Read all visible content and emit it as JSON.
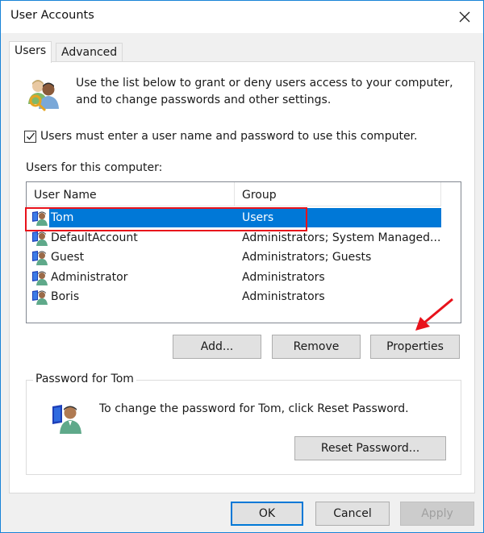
{
  "window": {
    "title": "User Accounts",
    "close_icon": "close-icon"
  },
  "tabs": [
    {
      "label": "Users",
      "active": true
    },
    {
      "label": "Advanced",
      "active": false
    }
  ],
  "users_tab": {
    "intro_icon": "users-key-icon",
    "intro_text_line1": "Use the list below to grant or deny users access to your computer,",
    "intro_text_line2": "and to change passwords and other settings.",
    "require_login_checkbox": {
      "label": "Users must enter a user name and password to use this computer.",
      "checked": true
    },
    "users_list_label": "Users for this computer:",
    "list": {
      "columns": [
        "User Name",
        "Group"
      ],
      "rows": [
        {
          "name": "Tom",
          "group": "Users",
          "selected": true,
          "icon": "user-computer-icon"
        },
        {
          "name": "DefaultAccount",
          "group": "Administrators; System Managed...",
          "selected": false,
          "icon": "user-computer-icon"
        },
        {
          "name": "Guest",
          "group": "Administrators; Guests",
          "selected": false,
          "icon": "user-computer-icon"
        },
        {
          "name": "Administrator",
          "group": "Administrators",
          "selected": false,
          "icon": "user-computer-icon"
        },
        {
          "name": "Boris",
          "group": "Administrators",
          "selected": false,
          "icon": "user-computer-icon"
        }
      ]
    },
    "buttons": {
      "add": "Add...",
      "remove": "Remove",
      "properties": "Properties"
    },
    "password_group": {
      "legend": "Password for Tom",
      "icon": "user-computer-icon",
      "text": "To change the password for Tom, click Reset Password.",
      "reset_button": "Reset Password..."
    }
  },
  "footer": {
    "ok": "OK",
    "cancel": "Cancel",
    "apply": "Apply",
    "apply_enabled": false
  },
  "annotations": {
    "highlight_color": "#e8121b",
    "arrow_color": "#e8121b"
  },
  "colors": {
    "selection": "#0078d7",
    "window_border": "#1883d7"
  }
}
